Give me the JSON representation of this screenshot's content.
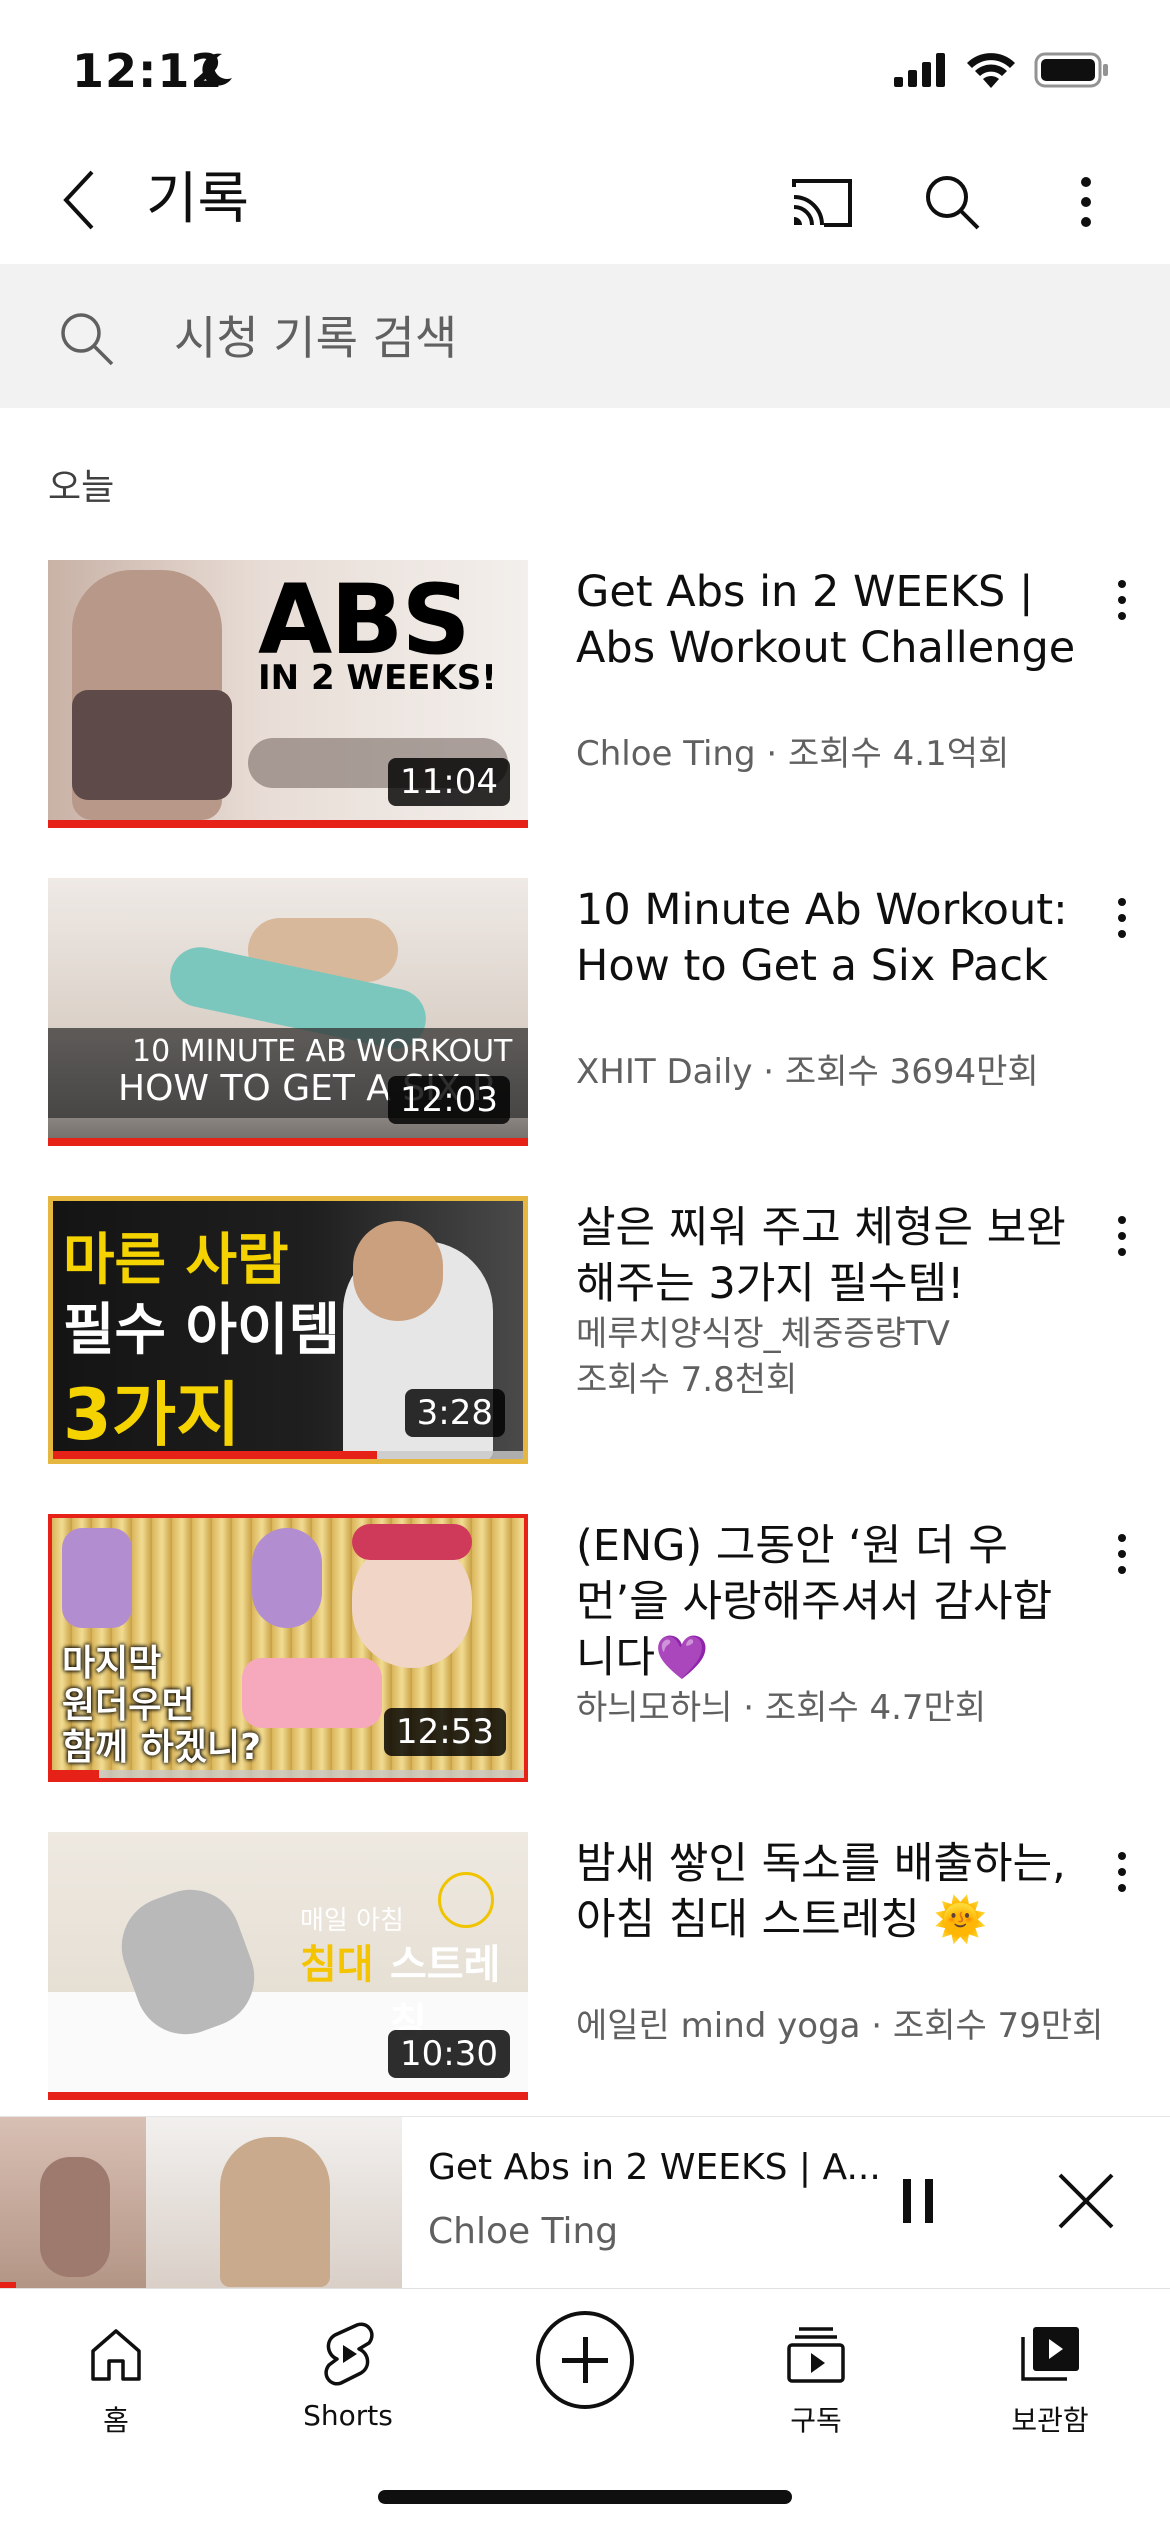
{
  "status_bar": {
    "time": "12:12"
  },
  "header": {
    "title": "기록"
  },
  "search": {
    "placeholder": "시청 기록 검색"
  },
  "section": {
    "label": "오늘"
  },
  "videos": [
    {
      "title": "Get Abs in 2 WEEKS | Abs Workout Challenge",
      "meta_line1": "Chloe Ting · 조회수 4.1억회",
      "meta_line2": "",
      "duration": "11:04",
      "progress": 1.0,
      "thumb_text1": "ABS",
      "thumb_text2": "IN 2 WEEKS!"
    },
    {
      "title": "10 Minute Ab Workout: How to Get a Six Pack",
      "meta_line1": "XHIT Daily · 조회수 3694만회",
      "meta_line2": "",
      "duration": "12:03",
      "progress": 1.0,
      "thumb_text1": "10 MINUTE AB WORKOUT",
      "thumb_text2": "HOW TO GET A SIX P"
    },
    {
      "title": "살은 찌워 주고 체형은 보완해주는 3가지 필수템!",
      "meta_line1": "메루치양식장_체중증량TV",
      "meta_line2": "조회수 7.8천회",
      "duration": "3:28",
      "progress": 0.69,
      "thumb_text1": "마른 사람",
      "thumb_text2": "필수 아이템",
      "thumb_text3": "3가지"
    },
    {
      "title": "(ENG) 그동안 ‘원 더 우먼’을 사랑해주셔서 감사합니다💜",
      "meta_line1": "하늬모하늬 · 조회수 4.7만회",
      "meta_line2": "",
      "duration": "12:53",
      "progress": 0.1,
      "thumb_text1": "마지막",
      "thumb_text2": "원더우먼",
      "thumb_text3": "함께 하겠니?"
    },
    {
      "title": "밤새 쌓인 독소를 배출하는, 아침 침대 스트레칭 🌞",
      "meta_line1": "에일린 mind yoga · 조회수 79만회",
      "meta_line2": "",
      "duration": "10:30",
      "progress": 1.0,
      "thumb_text1": "매일 아침",
      "thumb_text2": "침대",
      "thumb_text3": "스트레칭"
    }
  ],
  "mini_player": {
    "title": "Get Abs in 2 WEEKS | A...",
    "channel": "Chloe Ting"
  },
  "nav": {
    "home": "홈",
    "shorts": "Shorts",
    "subscriptions": "구독",
    "library": "보관함"
  },
  "colors": {
    "accent": "#e62117",
    "text": "#0f0f0f",
    "secondary": "#606060",
    "search_bg": "#f2f2f2"
  }
}
